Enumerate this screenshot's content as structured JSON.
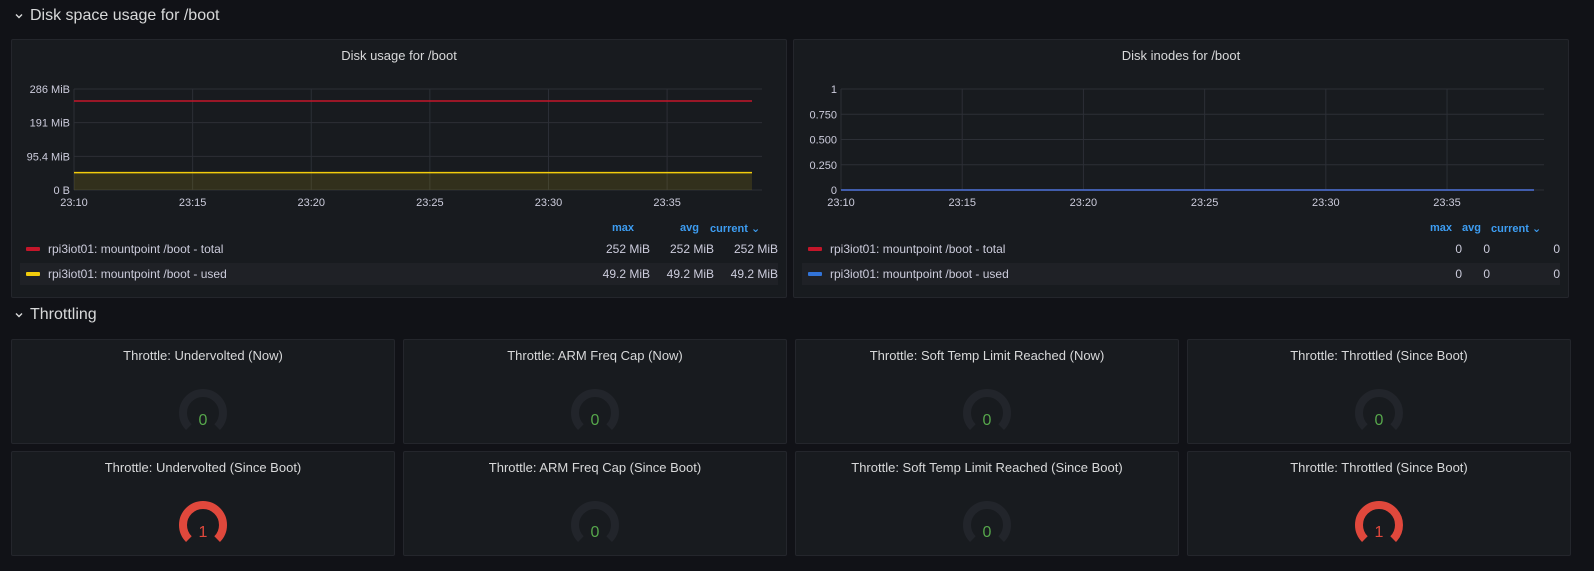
{
  "rows": {
    "disk": {
      "title": "Disk space usage for /boot"
    },
    "throttling": {
      "title": "Throttling"
    }
  },
  "colors": {
    "total": "#c4162a",
    "used_left": "#f2cc0c",
    "used_right": "#3274d9",
    "gauge_ok": "#22252b",
    "gauge_ok_text": "#56a64b",
    "gauge_bad": "#e0483c",
    "gauge_bad_text": "#e0483c",
    "legend_header": "#3d9df2"
  },
  "disk_usage": {
    "title": "Disk usage for /boot",
    "legend_headers": {
      "max": "max",
      "avg": "avg",
      "current": "current"
    },
    "series": [
      {
        "name": "rpi3iot01: mountpoint /boot - total",
        "max": "252 MiB",
        "avg": "252 MiB",
        "current": "252 MiB"
      },
      {
        "name": "rpi3iot01: mountpoint /boot - used",
        "max": "49.2 MiB",
        "avg": "49.2 MiB",
        "current": "49.2 MiB"
      }
    ]
  },
  "disk_inodes": {
    "title": "Disk inodes for /boot",
    "legend_headers": {
      "max": "max",
      "avg": "avg",
      "current": "current"
    },
    "series": [
      {
        "name": "rpi3iot01: mountpoint /boot - total",
        "max": "0",
        "avg": "0",
        "current": "0"
      },
      {
        "name": "rpi3iot01: mountpoint /boot - used",
        "max": "0",
        "avg": "0",
        "current": "0"
      }
    ]
  },
  "chart_data": [
    {
      "type": "line",
      "title": "Disk usage for /boot",
      "x_ticks": [
        "23:10",
        "23:15",
        "23:20",
        "23:25",
        "23:30",
        "23:35"
      ],
      "y_ticks": [
        "0 B",
        "95.4 MiB",
        "191 MiB",
        "286 MiB"
      ],
      "ylim": [
        0,
        286
      ],
      "x_range": [
        "23:10",
        "23:39"
      ],
      "series": [
        {
          "name": "rpi3iot01: mountpoint /boot - total",
          "values": [
            252,
            252
          ]
        },
        {
          "name": "rpi3iot01: mountpoint /boot - used",
          "values": [
            49.2,
            49.2
          ]
        }
      ],
      "grid": true
    },
    {
      "type": "line",
      "title": "Disk inodes for /boot",
      "x_ticks": [
        "23:10",
        "23:15",
        "23:20",
        "23:25",
        "23:30",
        "23:35"
      ],
      "y_ticks": [
        "0",
        "0.250",
        "0.500",
        "0.750",
        "1"
      ],
      "ylim": [
        0,
        1
      ],
      "x_range": [
        "23:10",
        "23:39"
      ],
      "series": [
        {
          "name": "rpi3iot01: mountpoint /boot - total",
          "values": [
            0,
            0
          ]
        },
        {
          "name": "rpi3iot01: mountpoint /boot - used",
          "values": [
            0,
            0
          ]
        }
      ],
      "grid": true
    }
  ],
  "gauges": [
    {
      "title": "Throttle: Undervolted (Now)",
      "value": "0",
      "active": false
    },
    {
      "title": "Throttle: ARM Freq Cap (Now)",
      "value": "0",
      "active": false
    },
    {
      "title": "Throttle: Soft Temp Limit Reached (Now)",
      "value": "0",
      "active": false
    },
    {
      "title": "Throttle: Throttled (Since Boot)",
      "value": "0",
      "active": false
    },
    {
      "title": "Throttle: Undervolted (Since Boot)",
      "value": "1",
      "active": true
    },
    {
      "title": "Throttle: ARM Freq Cap (Since Boot)",
      "value": "0",
      "active": false
    },
    {
      "title": "Throttle: Soft Temp Limit Reached (Since Boot)",
      "value": "0",
      "active": false
    },
    {
      "title": "Throttle: Throttled (Since Boot)",
      "value": "1",
      "active": true
    }
  ]
}
